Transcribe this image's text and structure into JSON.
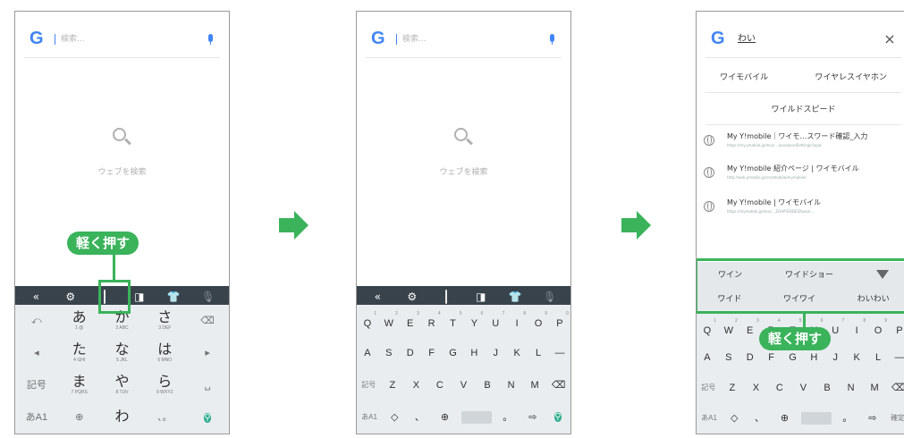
{
  "search": {
    "logo": "G",
    "placeholder": "検索...",
    "query": "わい"
  },
  "center": {
    "label": "ウェブを検索"
  },
  "callout": {
    "label": "軽く押す"
  },
  "toolbar_icons": [
    "chevron-left-icon",
    "gear-icon",
    "keyboard-mode-icon",
    "dictionary-icon",
    "shirt-icon",
    "mic-icon"
  ],
  "kana_keyboard": {
    "rows": [
      [
        {
          "main": "⤺",
          "sub": ""
        },
        {
          "main": "あ",
          "sub": "1 @"
        },
        {
          "main": "か",
          "sub": "2 ABC"
        },
        {
          "main": "さ",
          "sub": "3 DEF"
        },
        {
          "main": "⌫",
          "sub": ""
        }
      ],
      [
        {
          "main": "◂",
          "sub": ""
        },
        {
          "main": "た",
          "sub": "4 GHI"
        },
        {
          "main": "な",
          "sub": "5 JKL"
        },
        {
          "main": "は",
          "sub": "6 MNO"
        },
        {
          "main": "▸",
          "sub": ""
        }
      ],
      [
        {
          "main": "記号",
          "sub": ""
        },
        {
          "main": "ま",
          "sub": "7 PQRS"
        },
        {
          "main": "や",
          "sub": "8 TUV"
        },
        {
          "main": "ら",
          "sub": "9 WXYZ"
        },
        {
          "main": "␣",
          "sub": ""
        }
      ],
      [
        {
          "main": "あA1",
          "sub": ""
        },
        {
          "main": "⊕",
          "sub": ""
        },
        {
          "main": "わ",
          "sub": "0"
        },
        {
          "main": "、。",
          "sub": ""
        },
        {
          "main": "🔍",
          "sub": ""
        }
      ]
    ]
  },
  "qwerty": {
    "row1": [
      "Q",
      "W",
      "E",
      "R",
      "T",
      "Y",
      "U",
      "I",
      "O",
      "P"
    ],
    "row1_nums": [
      "1",
      "2",
      "3",
      "4",
      "5",
      "6",
      "7",
      "8",
      "9",
      "0"
    ],
    "row2": [
      "A",
      "S",
      "D",
      "F",
      "G",
      "H",
      "J",
      "K",
      "L",
      "—"
    ],
    "row3": [
      "記号",
      "Z",
      "X",
      "C",
      "V",
      "B",
      "N",
      "M",
      "⌫"
    ],
    "row4": [
      "あA1",
      "◇",
      "、",
      "⊕",
      "",
      "。",
      "⇨",
      "🔍"
    ],
    "row4_p3": [
      "あA1",
      "◇",
      "、",
      "⊕",
      "",
      "。",
      "⇨",
      "確定"
    ]
  },
  "suggestions": {
    "row1": [
      "ワイモバイル",
      "ワイヤレスイヤホン"
    ],
    "row2": [
      "ワイルドスピード"
    ],
    "results": [
      {
        "title": "My Y!mobile｜ワイモ…スワード確認_入力",
        "url": "https://my.ymobile.jp/muc/…/passwordSettings/input"
      },
      {
        "title": "My Y!mobile 紹介ページ | ワイモバイル",
        "url": "http://web.ymobile.jp/cmdmobile/mymobile/"
      },
      {
        "title": "My Y!mobile | ワイモバイル",
        "url": "https://mymobile.jp/muc/…ZHAPSFBDEIZbase/…"
      }
    ]
  },
  "candidates": {
    "row1": [
      "ワイン",
      "ワイドショー"
    ],
    "row2": [
      "ワイド",
      "ワイワイ",
      "わいわい"
    ]
  },
  "colors": {
    "accent": "#3ab35b",
    "toolbar": "#39434b",
    "search_key": "#2aab8c"
  }
}
